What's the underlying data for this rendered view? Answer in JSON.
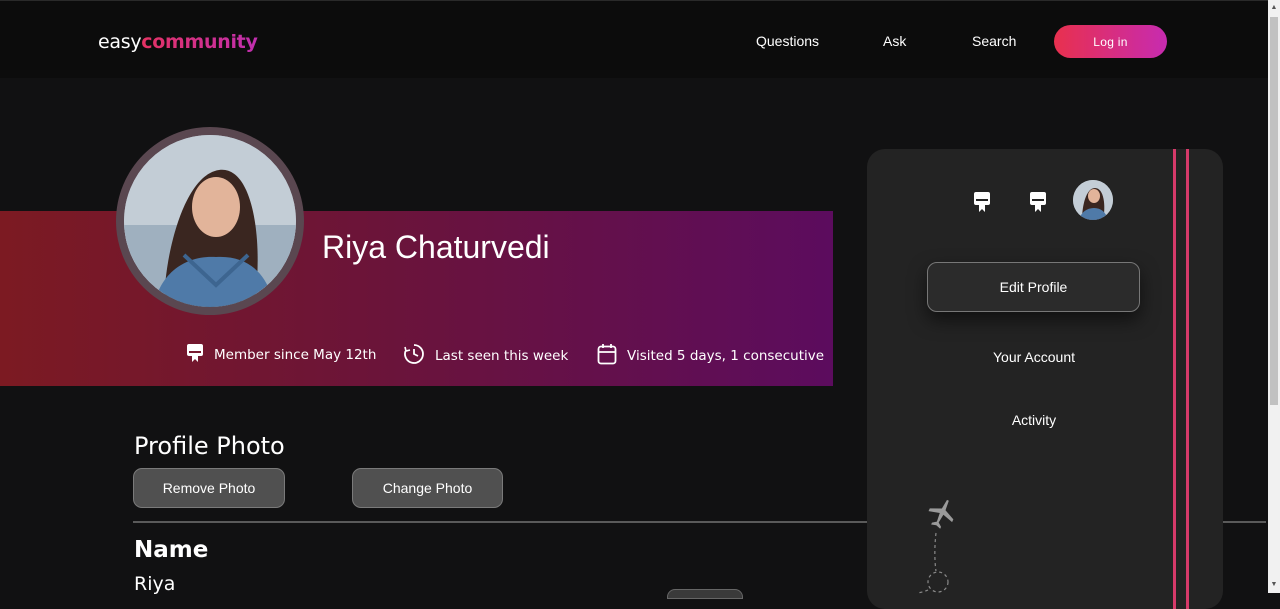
{
  "header": {
    "logo_part1": "easy",
    "logo_part2": "community",
    "nav": [
      "Questions",
      "Ask",
      "Search"
    ],
    "login_label": "Log in"
  },
  "profile": {
    "name": "Riya Chaturvedi",
    "meta": [
      {
        "icon": "badge-icon",
        "text": "Member since May 12th"
      },
      {
        "icon": "clock-icon",
        "text": "Last seen this week"
      },
      {
        "icon": "calendar-icon",
        "text": "Visited 5 days, 1 consecutive"
      }
    ]
  },
  "photo_section": {
    "title": "Profile Photo",
    "remove_label": "Remove Photo",
    "change_label": "Change Photo"
  },
  "name_section": {
    "label": "Name",
    "value": "Riya"
  },
  "side_card": {
    "icons": [
      "badge-icon",
      "badge-icon",
      "avatar"
    ],
    "edit_label": "Edit Profile",
    "links": [
      "Your Account",
      "Activity"
    ]
  },
  "colors": {
    "accent_start": "#e8304e",
    "accent_end": "#c72bb0",
    "banner_start": "#7c1a22",
    "banner_end": "#5c0c5e",
    "stripe": "#d63a6a"
  }
}
